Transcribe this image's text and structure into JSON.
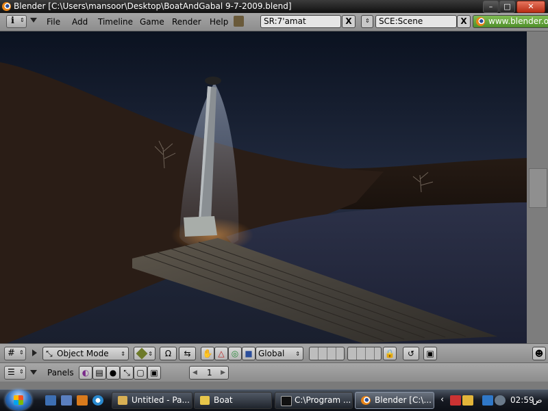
{
  "window": {
    "title": "Blender [C:\\Users\\mansoor\\Desktop\\BoatAndGabal 9-7-2009.blend]",
    "minimize_symbol": "–",
    "maximize_symbol": "□",
    "close_symbol": "✕"
  },
  "header": {
    "menus": [
      "File",
      "Add",
      "Timeline",
      "Game",
      "Render",
      "Help"
    ],
    "screen_field": "SR:7'amat",
    "scene_field": "SCE:Scene",
    "clear_symbol": "X",
    "url": "www.blender.org"
  },
  "view3d_header": {
    "mode": "Object Mode",
    "orientation": "Global"
  },
  "buttons_header": {
    "panels_label": "Panels",
    "frame": "1",
    "prev_symbol": "◀",
    "next_symbol": "▶"
  },
  "taskbar": {
    "tasks": [
      {
        "label": "Untitled - Pa..."
      },
      {
        "label": "Boat"
      },
      {
        "label": "C:\\Program ..."
      },
      {
        "label": "Blender [C:\\..."
      }
    ],
    "clock": "02:59",
    "clock_suffix": "ص"
  },
  "colors": {
    "blender_header": "#9a9a9a",
    "url_green": "#5c9a34",
    "taskbar": "#161a22"
  }
}
